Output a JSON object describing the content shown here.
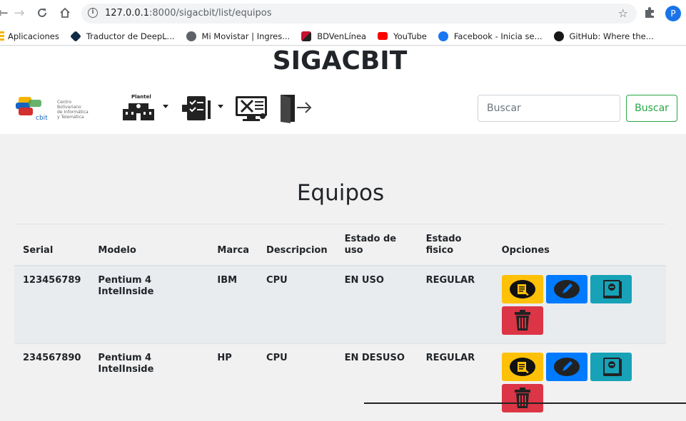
{
  "browser": {
    "url_host": "127.0.0.1",
    "url_path": ":8000/sigacbit/list/equipos",
    "profile_initial": "P",
    "bookmarks": [
      {
        "label": "Aplicaciones",
        "icon": "apps-grid-icon",
        "color": "#f4b400"
      },
      {
        "label": "Traductor de DeepL...",
        "icon": "deepl-icon",
        "color": "#0f2b46"
      },
      {
        "label": "Mi Movistar | Ingres...",
        "icon": "globe-icon",
        "color": "#5f6368"
      },
      {
        "label": "BDVenLínea",
        "icon": "bdv-icon",
        "color": "#c8102e"
      },
      {
        "label": "YouTube",
        "icon": "youtube-icon",
        "color": "#ff0000"
      },
      {
        "label": "Facebook - Inicia se...",
        "icon": "facebook-icon",
        "color": "#1877f2"
      },
      {
        "label": "GitHub: Where the...",
        "icon": "github-icon",
        "color": "#181717"
      }
    ]
  },
  "header": {
    "brand": "SIGACBIT",
    "logo_lines": [
      "Centro",
      "Bolivariano",
      "de Informática",
      "y Telemática"
    ],
    "logo_mark": "cbit",
    "plantel_label": "Plantel",
    "search": {
      "placeholder": "Buscar",
      "button_label": "Buscar"
    }
  },
  "main": {
    "title": "Equipos",
    "columns": [
      "Serial",
      "Modelo",
      "Marca",
      "Descripcion",
      "Estado de uso",
      "Estado fisico",
      "Opciones"
    ],
    "rows": [
      {
        "serial": "123456789",
        "modelo": "Pentium 4 IntelInside",
        "marca": "IBM",
        "descripcion": "CPU",
        "estado_uso": "EN USO",
        "estado_fisico": "REGULAR"
      },
      {
        "serial": "234567890",
        "modelo": "Pentium 4 IntelInside",
        "marca": "HP",
        "descripcion": "CPU",
        "estado_uso": "EN DESUSO",
        "estado_fisico": "REGULAR"
      }
    ]
  },
  "colors": {
    "warning": "#ffc107",
    "primary": "#007bff",
    "info": "#17a2b8",
    "danger": "#dc3545",
    "success": "#28a745"
  }
}
